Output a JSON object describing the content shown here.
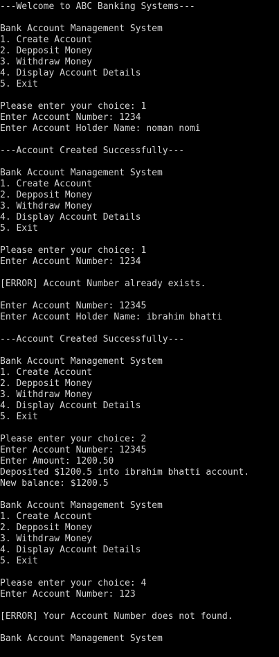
{
  "terminal": {
    "lines": [
      "---Welcome to ABC Banking Systems---",
      "",
      "Bank Account Management System",
      "1. Create Account",
      "2. Depposit Money",
      "3. Withdraw Money",
      "4. Display Account Details",
      "5. Exit",
      "",
      "Please enter your choice: 1",
      "Enter Account Number: 1234",
      "Enter Account Holder Name: noman nomi",
      "",
      "---Account Created Successfully---",
      "",
      "Bank Account Management System",
      "1. Create Account",
      "2. Depposit Money",
      "3. Withdraw Money",
      "4. Display Account Details",
      "5. Exit",
      "",
      "Please enter your choice: 1",
      "Enter Account Number: 1234",
      "",
      "[ERROR] Account Number already exists.",
      "",
      "Enter Account Number: 12345",
      "Enter Account Holder Name: ibrahim bhatti",
      "",
      "---Account Created Successfully---",
      "",
      "Bank Account Management System",
      "1. Create Account",
      "2. Depposit Money",
      "3. Withdraw Money",
      "4. Display Account Details",
      "5. Exit",
      "",
      "Please enter your choice: 2",
      "Enter Account Number: 12345",
      "Enter Amount: 1200.50",
      "Deposited $1200.5 into ibrahim bhatti account.",
      "New balance: $1200.5",
      "",
      "Bank Account Management System",
      "1. Create Account",
      "2. Depposit Money",
      "3. Withdraw Money",
      "4. Display Account Details",
      "5. Exit",
      "",
      "Please enter your choice: 4",
      "Enter Account Number: 123",
      "",
      "[ERROR] Your Account Number does not found.",
      "",
      "Bank Account Management System"
    ]
  }
}
